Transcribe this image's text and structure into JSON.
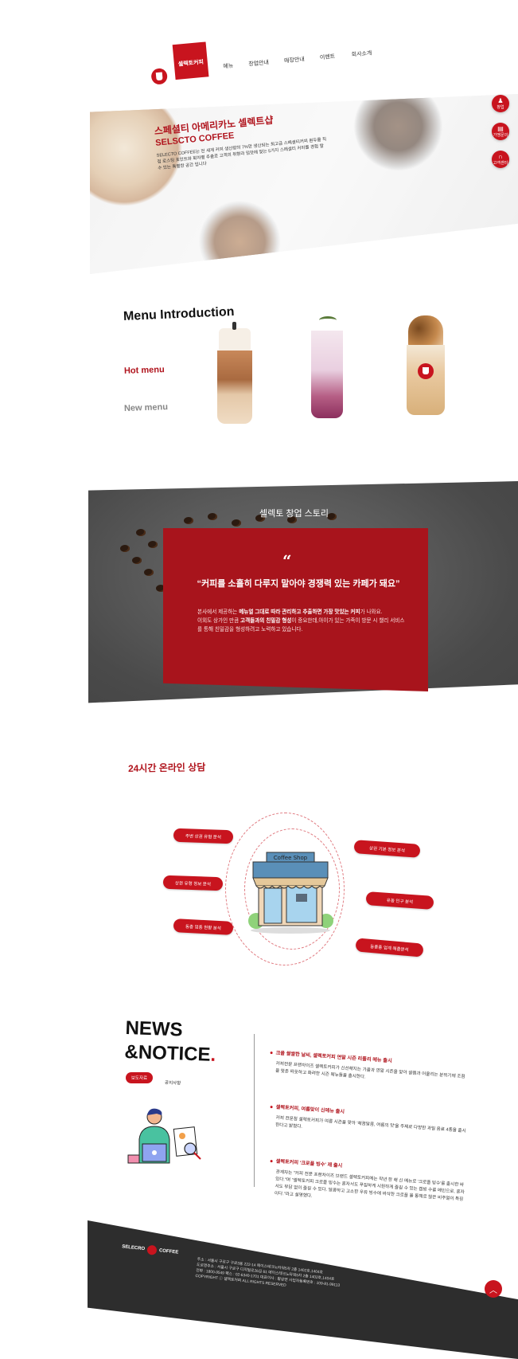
{
  "nav": {
    "items": [
      "셀렉토커피",
      "메뉴",
      "창업안내",
      "매장안내",
      "이벤트",
      "회사소개"
    ]
  },
  "hero": {
    "title_line1": "스페셜티 아메리카노 셀렉트샵",
    "title_line2": "SELSCTO COFFEE",
    "desc": "SELECTO COFFEE는 전 세계 커피 생산량의 7%만 생산되는 최고급 스페셜티커피 원두를 직접 로스팅 포인트와 회차별 추출로 고객의 취향과 입맛에 맞는 5가지 스페셜티 커피를 경험 할 수 있는 특별한 공간 입니다"
  },
  "side_buttons": [
    {
      "icon": "people-icon",
      "label": "창업"
    },
    {
      "icon": "store-icon",
      "label": "가맹문의"
    },
    {
      "icon": "headset-icon",
      "label": "고객센터"
    }
  ],
  "menu_intro": {
    "title": "Menu Introduction",
    "hot": "Hot menu",
    "new": "New menu"
  },
  "story": {
    "title": "셀렉토 창업 스토리",
    "quote_mark": "“",
    "quote": "“커피를 소홀히 다루지 말아야 경쟁력 있는 카페가 돼요”",
    "line1_pre": "본사에서 제공하는 ",
    "line1_bold": "메뉴얼 그대로 따라 관리하고 추출하면 가장 맛있는 커피",
    "line1_post": "가 나와요.",
    "line2_pre": "이외도 상가인 만큼 ",
    "line2_bold": "고객들과의 친밀감 형성",
    "line2_post": "이 중요한데,아이가 있는 가족이 방문 시 챌리 서비스를 통해 친밀감을 형성하려고 노력하고 있습니다."
  },
  "consult": {
    "title": "24시간 온라인 상담",
    "pills": [
      "주변 상권 유형 분석",
      "상권 유형 정보 분석",
      "동종 업종 현황 분석",
      "상권 기본 정보 분석",
      "유동 인구 분석",
      "동종종 업계 매출분석"
    ],
    "shop_sign": "Coffee Shop"
  },
  "news": {
    "title_line1": "NEWS",
    "title_line2": "&NOTICE",
    "title_dot": ".",
    "tabs": [
      "보도자료",
      "공지사항"
    ],
    "items": [
      {
        "title": "크을 쌀쌀한 날씨, 셀렉토커피 연말 시즌 리플리 메뉴 출시",
        "body": "커피전문 프랜차이즈 셀렉토커피가 신선해지는 가을과 연말 시즌을 맞아 설렘과 어울리는 분위기에 조점을 맞춘 따듯하고 화려한 시즌 메뉴들을 출시한다."
      },
      {
        "title": "셀렉토커피, 여름맞이 신메뉴 출시",
        "body": "커피 전문점 셀렉토커피가 여름 시즌을 맞아 '채꿈달콤, 여름의 맛'을 주제로 다양한 과일 음료 4종을 출시한다고 밝혔다."
      },
      {
        "title": "셀렉토커피 '크로플 빙수' 재 출시",
        "body": "관계자는 \"커피 전문 프랜차이즈 브랜드 셀렉토커피에는 작년 한 해 신 메뉴로 '크로플 빙수'를 출시한 바 있다.\"며 \"셀렉토커피 크로플 빙수는 혼자서도 푸짐하게 시원하게 즐길 수 있는 캡빙 수를 메인으로, 혼자서도 부담 없이 즐길 수 있다. 달콤하고 고소한 우유 빙수에 바삭한 크로플 을 통해로 많은 비주얼이 특징이다.\"라고 설명했다."
      }
    ]
  },
  "footer": {
    "logo_left": "SELECRO",
    "logo_right": "COFFEE",
    "lines": [
      "주소 : 서울시 구로구 구로3동 222-14 에이스테크노타워5차 2층 1402호,1404호",
      "도로명주소 : 서울시 구로구 디지털로26길 61 에이스테크노타워5차 2층 1402호,1404호",
      "전화 : 1800-9549  팩스 : 02-6340-1701  대표이사 : 황상연  사업자등록번호 : 109-81-99113",
      "COPYRIGHT ⓒ 셀렉토커피 ALL RIGHTS RESERVED"
    ]
  },
  "colors": {
    "brand": "#c8141e",
    "dark": "#2d2d2d"
  }
}
